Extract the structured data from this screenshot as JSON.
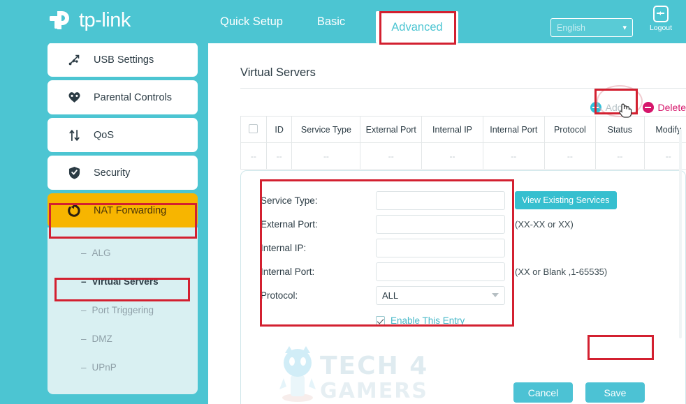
{
  "header": {
    "brand": "tp-link",
    "brand_icon": "tplink-logo-icon",
    "nav": [
      {
        "label": "Quick Setup",
        "active": false
      },
      {
        "label": "Basic",
        "active": false
      },
      {
        "label": "Advanced",
        "active": true
      }
    ],
    "language": {
      "value": "English",
      "icon": "chevron-down-icon"
    },
    "logout": {
      "label": "Logout",
      "icon": "logout-icon"
    }
  },
  "sidebar": {
    "items": [
      {
        "label": "",
        "icon": "",
        "state": "partial"
      },
      {
        "label": "USB Settings",
        "icon": "usb-icon",
        "state": "normal"
      },
      {
        "label": "Parental Controls",
        "icon": "heart-icon",
        "state": "normal"
      },
      {
        "label": "QoS",
        "icon": "updown-arrows-icon",
        "state": "normal"
      },
      {
        "label": "Security",
        "icon": "shield-check-icon",
        "state": "normal"
      },
      {
        "label": "NAT Forwarding",
        "icon": "nat-refresh-icon",
        "state": "active"
      }
    ],
    "sub_items": [
      {
        "label": "ALG",
        "selected": false
      },
      {
        "label": "Virtual Servers",
        "selected": true
      },
      {
        "label": "Port Triggering",
        "selected": false
      },
      {
        "label": "DMZ",
        "selected": false
      },
      {
        "label": "UPnP",
        "selected": false
      }
    ],
    "dash": "–"
  },
  "main": {
    "title": "Virtual Servers",
    "actions": {
      "add": {
        "label": "Add",
        "icon": "plus-circle-icon"
      },
      "delete": {
        "label": "Delete",
        "icon": "minus-circle-icon"
      }
    },
    "table": {
      "headers": [
        "",
        "ID",
        "Service Type",
        "External Port",
        "Internal IP",
        "Internal Port",
        "Protocol",
        "Status",
        "Modify"
      ],
      "rows": [
        [
          "--",
          "--",
          "--",
          "--",
          "--",
          "--",
          "--",
          "--",
          "--"
        ]
      ],
      "select_all_icon": "checkbox-icon"
    },
    "form": {
      "fields": [
        {
          "label": "Service Type:",
          "value": "",
          "hint": "",
          "button": "View Existing Services",
          "type": "text"
        },
        {
          "label": "External Port:",
          "value": "",
          "hint": "(XX-XX or XX)",
          "button": "",
          "type": "text"
        },
        {
          "label": "Internal IP:",
          "value": "",
          "hint": "",
          "button": "",
          "type": "text"
        },
        {
          "label": "Internal Port:",
          "value": "",
          "hint": "(XX or Blank ,1-65535)",
          "button": "",
          "type": "text"
        },
        {
          "label": "Protocol:",
          "value": "ALL",
          "hint": "",
          "button": "",
          "type": "select"
        }
      ],
      "enable": {
        "label": "Enable This Entry",
        "checked": true,
        "icon": "checkbox-checked-icon"
      },
      "cancel": "Cancel",
      "save": "Save"
    }
  },
  "watermark": {
    "line1": "TECH 4",
    "line2": "GAMERS",
    "mascot_icon": "mascot-icon"
  },
  "colors": {
    "brand_cyan": "#4CC5D2",
    "accent_yellow": "#F7B500",
    "highlight_red": "#D32030",
    "delete_pink": "#D6166B",
    "add_cyan": "#2FC2DC",
    "link_cyan": "#49B9C9"
  }
}
